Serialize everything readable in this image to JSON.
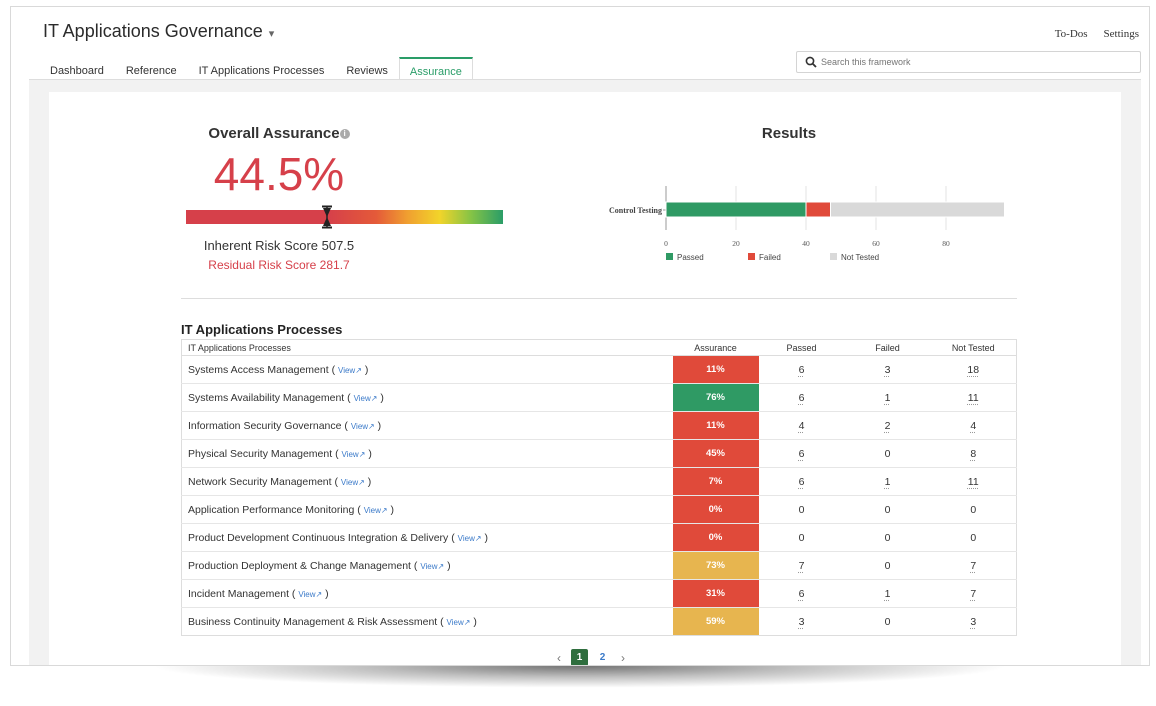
{
  "app": {
    "title": "IT Applications Governance",
    "top_links": [
      "To-Dos",
      "Settings"
    ]
  },
  "tabs": [
    {
      "label": "Dashboard",
      "active": false
    },
    {
      "label": "Reference",
      "active": false
    },
    {
      "label": "IT Applications Processes",
      "active": false
    },
    {
      "label": "Reviews",
      "active": false
    },
    {
      "label": "Assurance",
      "active": true
    }
  ],
  "search": {
    "placeholder": "Search this framework"
  },
  "overall_assurance": {
    "title": "Overall Assurance",
    "value_label": "44.5%",
    "gauge_position_percent": 44.5,
    "inherent_risk": "Inherent Risk Score 507.5",
    "residual_risk": "Residual Risk Score 281.7"
  },
  "results": {
    "title": "Results"
  },
  "chart_data": {
    "type": "bar",
    "orientation": "horizontal",
    "stacked": true,
    "categories": [
      "Control Testing"
    ],
    "series": [
      {
        "name": "Passed",
        "values": [
          40
        ],
        "color": "#2f9a64"
      },
      {
        "name": "Failed",
        "values": [
          7
        ],
        "color": "#e04a3a"
      },
      {
        "name": "Not Tested",
        "values": [
          53
        ],
        "color": "#d9d9d9"
      }
    ],
    "xlim": [
      0,
      100
    ],
    "xticks": [
      0,
      20,
      40,
      60,
      80,
      100
    ],
    "grid": true,
    "legend_position": "bottom"
  },
  "table": {
    "title": "IT Applications Processes",
    "view_label": "View",
    "headers": {
      "name": "IT Applications Processes",
      "assurance": "Assurance",
      "passed": "Passed",
      "failed": "Failed",
      "not_tested": "Not Tested"
    },
    "rows": [
      {
        "name": "Systems Access Management",
        "assurance": "11%",
        "color": "#e04a3a",
        "passed": "6",
        "failed": "3",
        "not_tested": "18"
      },
      {
        "name": "Systems Availability Management",
        "assurance": "76%",
        "color": "#2f9a64",
        "passed": "6",
        "failed": "1",
        "not_tested": "11"
      },
      {
        "name": "Information Security Governance",
        "assurance": "11%",
        "color": "#e04a3a",
        "passed": "4",
        "failed": "2",
        "not_tested": "4"
      },
      {
        "name": "Physical Security Management",
        "assurance": "45%",
        "color": "#e04a3a",
        "passed": "6",
        "failed": "0",
        "not_tested": "8"
      },
      {
        "name": "Network Security Management",
        "assurance": "7%",
        "color": "#e04a3a",
        "passed": "6",
        "failed": "1",
        "not_tested": "11"
      },
      {
        "name": "Application Performance Monitoring",
        "assurance": "0%",
        "color": "#e04a3a",
        "passed": "0",
        "failed": "0",
        "not_tested": "0"
      },
      {
        "name": "Product Development Continuous Integration & Delivery",
        "assurance": "0%",
        "color": "#e04a3a",
        "passed": "0",
        "failed": "0",
        "not_tested": "0"
      },
      {
        "name": "Production Deployment & Change Management",
        "assurance": "73%",
        "color": "#e7b54f",
        "passed": "7",
        "failed": "0",
        "not_tested": "7"
      },
      {
        "name": "Incident Management",
        "assurance": "31%",
        "color": "#e04a3a",
        "passed": "6",
        "failed": "1",
        "not_tested": "7"
      },
      {
        "name": "Business Continuity Management & Risk Assessment",
        "assurance": "59%",
        "color": "#e7b54f",
        "passed": "3",
        "failed": "0",
        "not_tested": "3"
      }
    ]
  },
  "pagination": {
    "prev": "‹",
    "next": "›",
    "pages": [
      "1",
      "2"
    ],
    "current": "1"
  }
}
